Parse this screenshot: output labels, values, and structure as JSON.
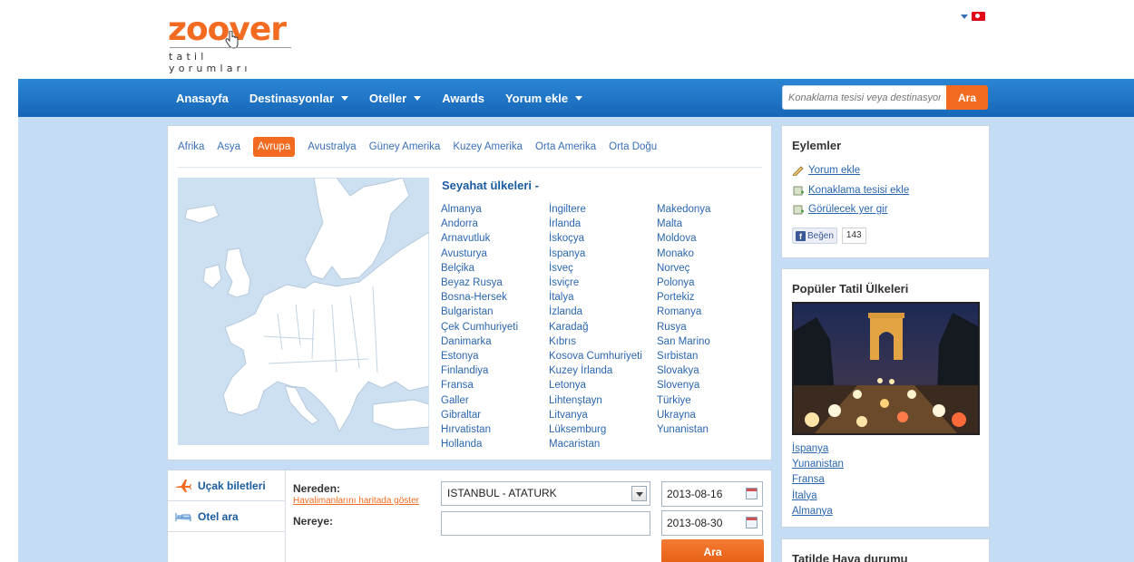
{
  "logo": {
    "word": "zoover",
    "tagline": "tatil yorumları"
  },
  "nav": {
    "items": [
      {
        "label": "Anasayfa",
        "dropdown": false
      },
      {
        "label": "Destinasyonlar",
        "dropdown": true
      },
      {
        "label": "Oteller",
        "dropdown": true
      },
      {
        "label": "Awards",
        "dropdown": false
      },
      {
        "label": "Yorum ekle",
        "dropdown": true
      }
    ],
    "search_placeholder": "Konaklama tesisi veya destinasyon",
    "search_button": "Ara"
  },
  "regions": {
    "tabs": [
      "Afrika",
      "Asya",
      "Avrupa",
      "Avustralya",
      "Güney Amerika",
      "Kuzey Amerika",
      "Orta Amerika",
      "Orta Doğu"
    ],
    "active": "Avrupa",
    "title": "Seyahat ülkeleri -",
    "col1": [
      "Almanya",
      "Andorra",
      "Arnavutluk",
      "Avusturya",
      "Belçika",
      "Beyaz Rusya",
      "Bosna-Hersek",
      "Bulgaristan",
      "Çek Cumhuriyeti",
      "Danimarka",
      "Estonya",
      "Finlandiya",
      "Fransa",
      "Galler",
      "Gibraltar",
      "Hırvatistan",
      "Hollanda"
    ],
    "col2": [
      "İngiltere",
      "İrlanda",
      "İskoçya",
      "İspanya",
      "İsveç",
      "İsviçre",
      "İtalya",
      "İzlanda",
      "Karadağ",
      "Kıbrıs",
      "Kosova Cumhuriyeti",
      "Kuzey İrlanda",
      "Letonya",
      "Lihtenştayn",
      "Litvanya",
      "Lüksemburg",
      "Macaristan"
    ],
    "col3": [
      "Makedonya",
      "Malta",
      "Moldova",
      "Monako",
      "Norveç",
      "Polonya",
      "Portekiz",
      "Romanya",
      "Rusya",
      "San Marino",
      "Sırbistan",
      "Slovakya",
      "Slovenya",
      "Türkiye",
      "Ukrayna",
      "Yunanistan"
    ]
  },
  "actions": {
    "title": "Eylemler",
    "items": [
      "Yorum ekle",
      "Konaklama tesisi ekle",
      "Görülecek yer gir"
    ],
    "like_label": "Beğen",
    "like_count": "143"
  },
  "popular": {
    "title": "Popüler Tatil Ülkeleri",
    "links": [
      "İspanya",
      "Yunanistan",
      "Fransa",
      "İtalya",
      "Almanya"
    ]
  },
  "weather": {
    "title": "Tatilde Hava durumu"
  },
  "search": {
    "tabs": [
      "Uçak biletleri",
      "Otel ara"
    ],
    "from_label": "Nereden:",
    "map_link": "Havalimanlarını haritada göster",
    "to_label": "Nereye:",
    "from_value": "ISTANBUL - ATATURK",
    "to_value": "",
    "date1": "2013-08-16",
    "date2": "2013-08-30",
    "button": "Ara"
  },
  "colors": {
    "brand": "#f26b21",
    "nav": "#1a6fc0",
    "link": "#2a66b0",
    "bg": "#c4ddf5"
  }
}
